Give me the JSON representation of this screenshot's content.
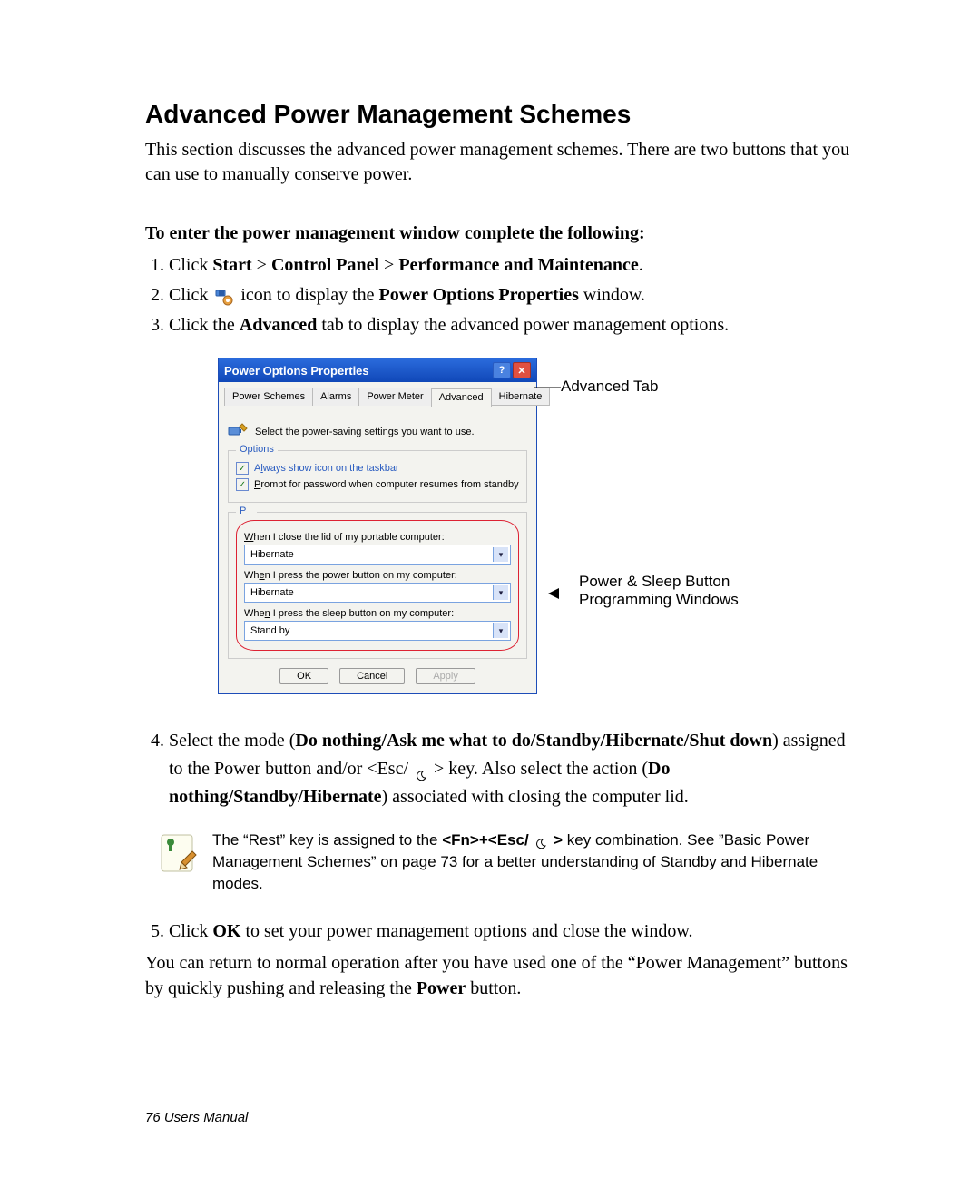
{
  "page": {
    "title": "Advanced Power Management Schemes",
    "intro": "This section discusses the advanced power management schemes. There are two buttons that you can use to manually conserve power.",
    "subheading": "To enter the power management window complete the following:",
    "footer": "76  Users Manual",
    "step1_prefix": "Click ",
    "step1_start": "Start",
    "step1_gt": " > ",
    "step1_cp": "Control Panel",
    "step1_pm": "Performance and Maintenance",
    "step2_prefix": "Click ",
    "step2_mid": " icon to display the ",
    "step2_bold": "Power Options Properties",
    "step2_suffix": " window.",
    "step3_prefix": "Click the ",
    "step3_bold": "Advanced",
    "step3_suffix": " tab to display the advanced power management options.",
    "step4_prefix": "Select the mode (",
    "step4_bold1": "Do nothing/Ask me what to do/Standby/Hibernate/Shut down",
    "step4_mid1": ") assigned to the Power button and/or <Esc/ ",
    "step4_mid2": " > key. Also select the action (",
    "step4_bold2": "Do nothing/Standby/Hibernate",
    "step4_suffix": ") associated with closing the computer lid.",
    "step5_prefix": "Click ",
    "step5_bold": "OK",
    "step5_suffix": " to set your power management options and close the window.",
    "closing_a": "You can return to normal operation after you have used one of the “Power Management” buttons by quickly pushing and releasing the ",
    "closing_bold": "Power",
    "closing_b": " button."
  },
  "note": {
    "a": "The “Rest” key is assigned to the ",
    "bold1": "<Fn>+<Esc/ ",
    "bold2": " >",
    "b": " key combination. See ”Basic Power Management Schemes” on page 73 for a better understanding of Standby and Hibernate modes."
  },
  "callouts": {
    "advanced_tab": "Advanced Tab",
    "power_sleep": "Power  & Sleep Button\nProgramming Windows"
  },
  "dialog": {
    "title": "Power Options Properties",
    "tabs": [
      "Power Schemes",
      "Alarms",
      "Power Meter",
      "Advanced",
      "Hibernate"
    ],
    "active_tab_index": 3,
    "instruction": "Select the power-saving settings you want to use.",
    "options_legend": "Options",
    "checkbox1_pre": "A",
    "checkbox1_u": "l",
    "checkbox1_post": "ways show icon on the taskbar",
    "checkbox2_pre": "",
    "checkbox2_u": "P",
    "checkbox2_post": "rompt for password when computer resumes from standby",
    "power_buttons_legend_partial": "P",
    "pb_label1_pre": "",
    "pb_label1_u": "W",
    "pb_label1_post": "hen I close the lid of my portable computer:",
    "pb_value1": "Hibernate",
    "pb_label2_pre": "Wh",
    "pb_label2_u": "e",
    "pb_label2_post": "n I press the power button on my computer:",
    "pb_value2": "Hibernate",
    "pb_label3_pre": "Whe",
    "pb_label3_u": "n",
    "pb_label3_post": " I press the sleep button on my computer:",
    "pb_value3": "Stand by",
    "btn_ok": "OK",
    "btn_cancel": "Cancel",
    "btn_apply": "Apply"
  }
}
